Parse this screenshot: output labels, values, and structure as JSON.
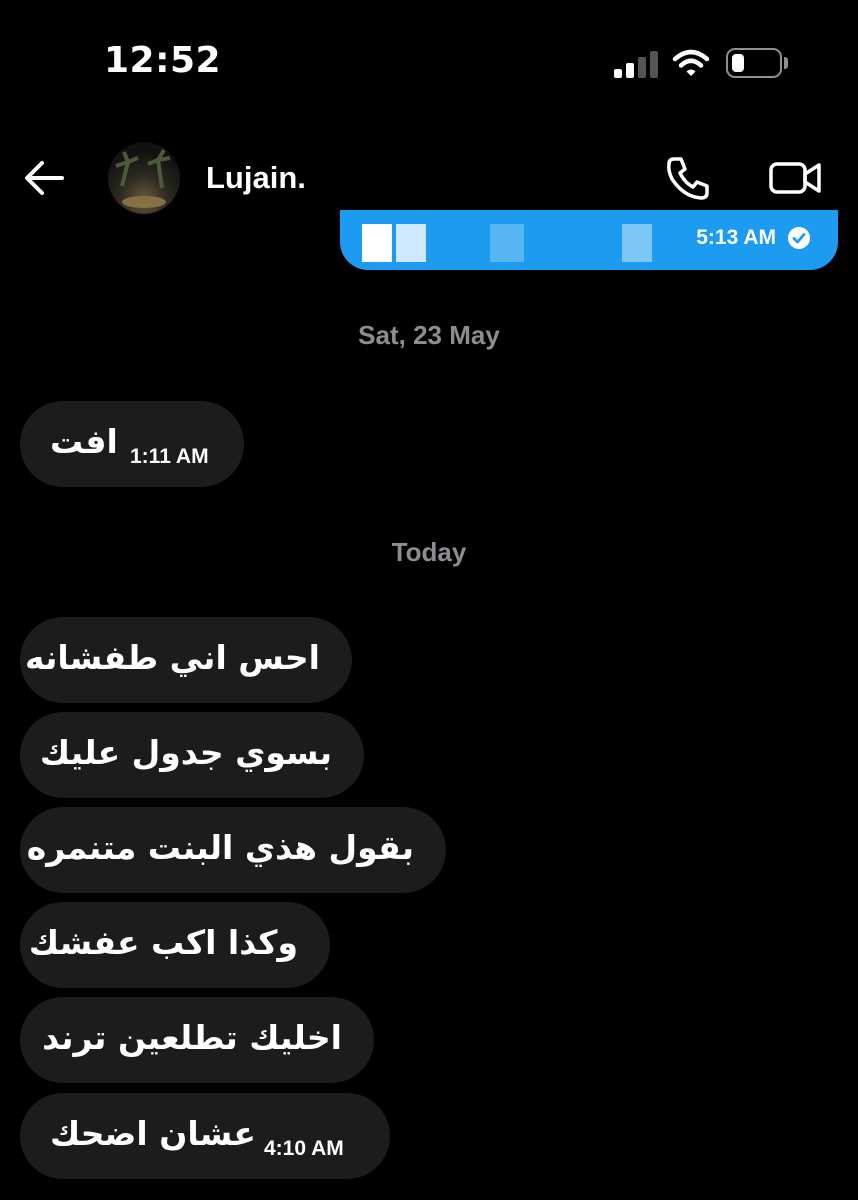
{
  "status_bar": {
    "time": "12:52"
  },
  "header": {
    "contact_name": "Lujain."
  },
  "sent_preview": {
    "time": "5:13 AM"
  },
  "separators": {
    "first": "Sat, 23 May",
    "second": "Today"
  },
  "messages": [
    {
      "text": "افت",
      "time": "1:11 AM"
    },
    {
      "text": "احس اني طفشانه"
    },
    {
      "text": "بسوي جدول عليك"
    },
    {
      "text": "بقول هذي البنت متنمره"
    },
    {
      "text": "وكذا اكب عفشك"
    },
    {
      "text": "اخليك تطلعين ترند"
    },
    {
      "text": "عشان اضحك",
      "time": "4:10 AM"
    }
  ],
  "colors": {
    "sent_bubble": "#1d9bf0",
    "received_bubble": "#1c1c1e",
    "separator_text": "#8b8d91",
    "background": "#000000"
  },
  "icons": [
    "back-arrow-icon",
    "phone-icon",
    "video-camera-icon",
    "signal-icon",
    "wifi-icon",
    "battery-icon",
    "read-check-icon"
  ]
}
